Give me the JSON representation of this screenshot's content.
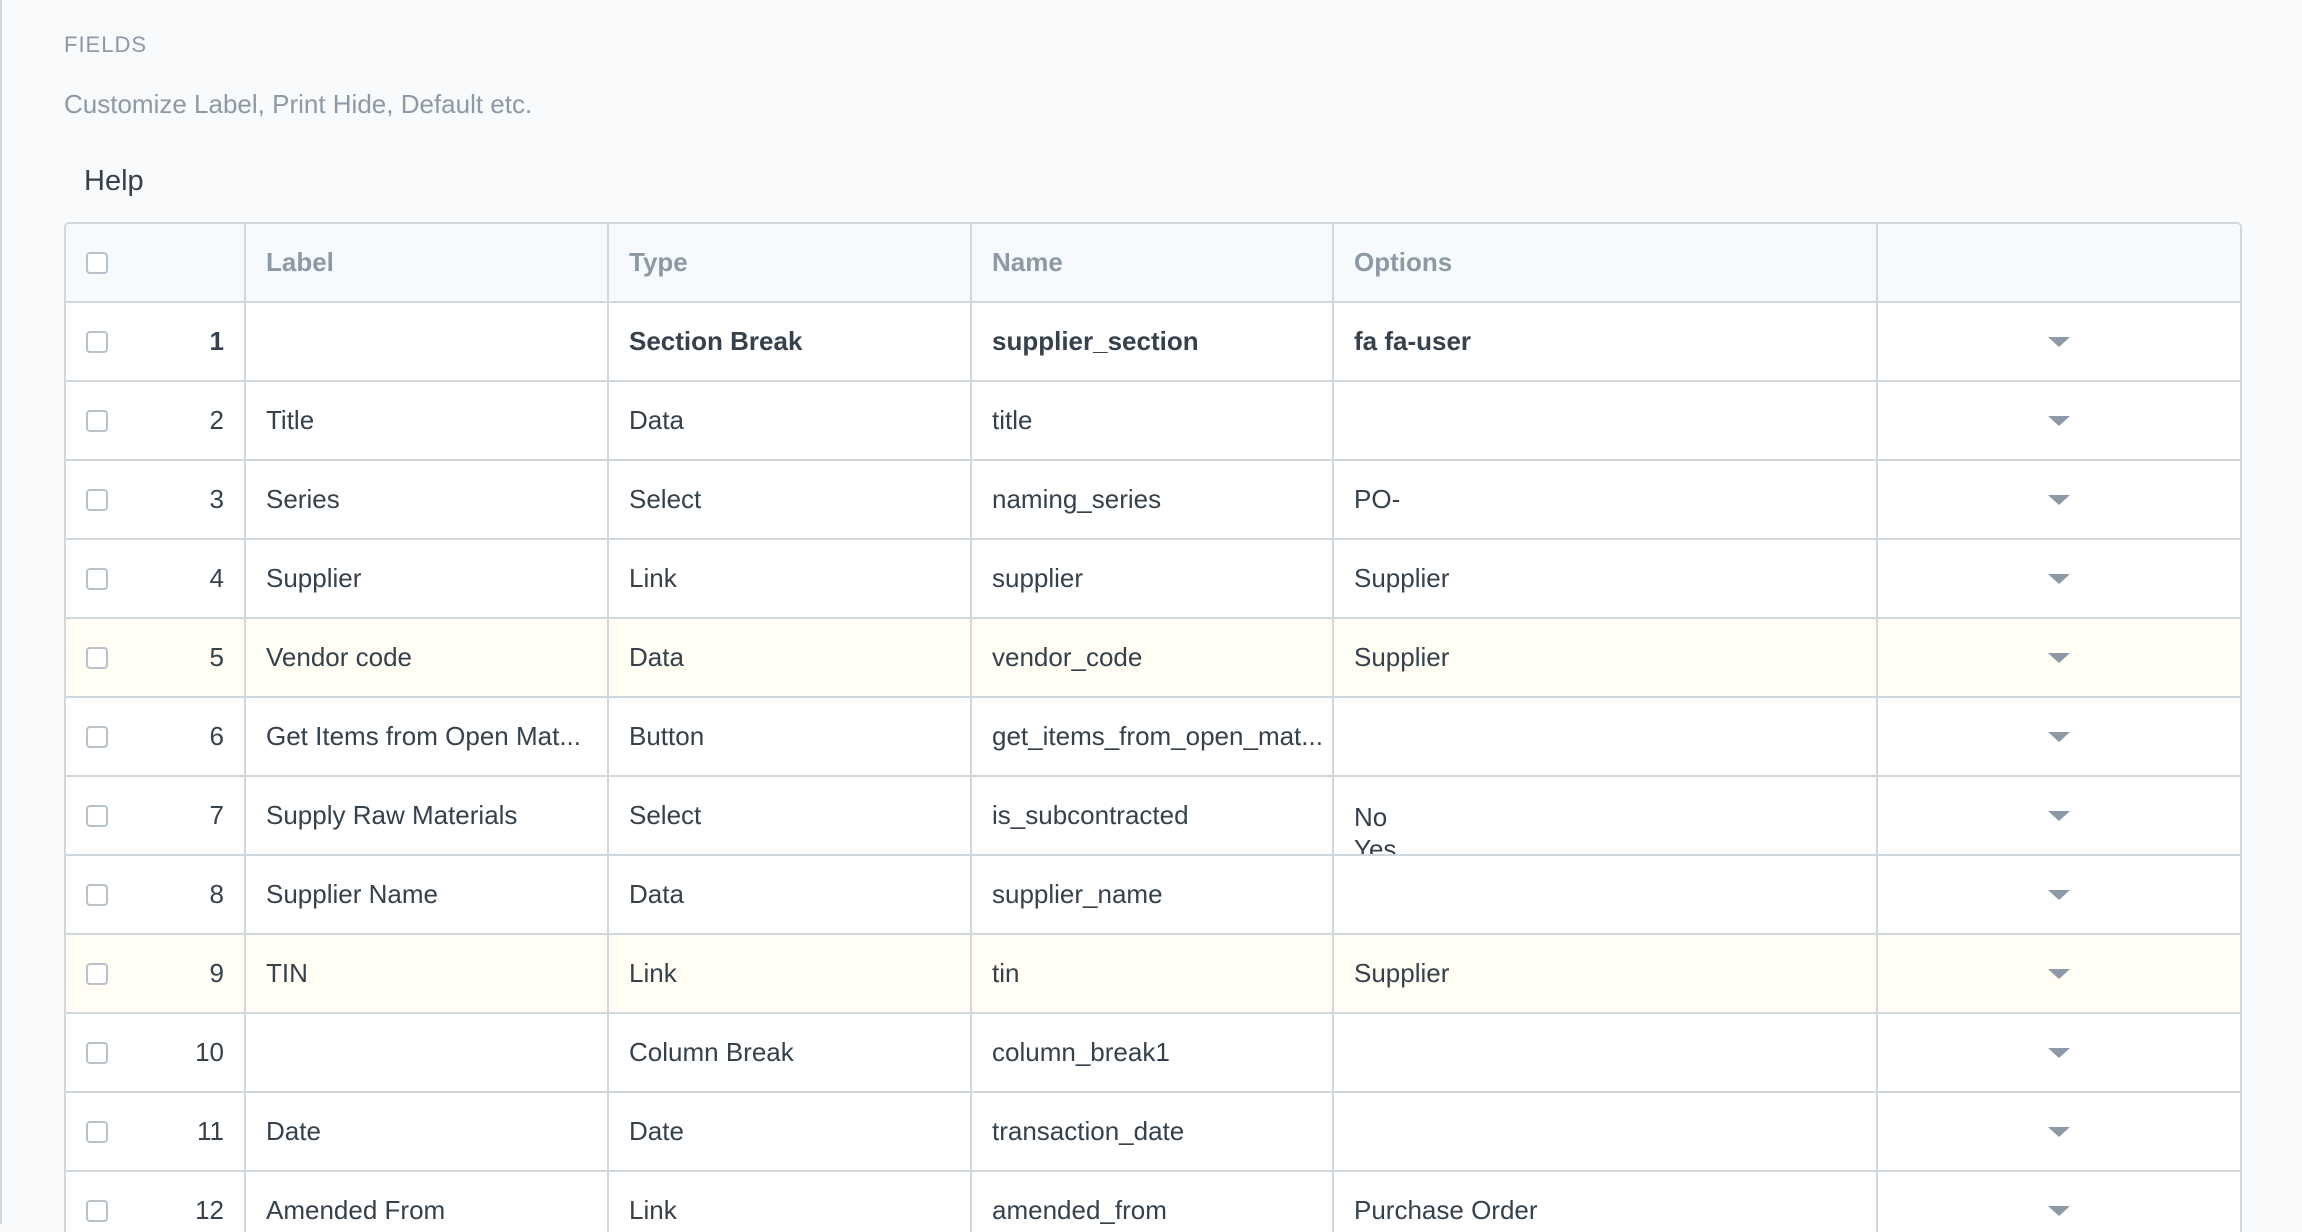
{
  "section": {
    "heading": "FIELDS",
    "description": "Customize Label, Print Hide, Default etc.",
    "help_label": "Help"
  },
  "grid": {
    "columns": {
      "label": "Label",
      "type": "Type",
      "name": "Name",
      "options": "Options"
    },
    "rows": [
      {
        "idx": "1",
        "label": "",
        "type": "Section Break",
        "name": "supplier_section",
        "options": "fa fa-user",
        "options2": ""
      },
      {
        "idx": "2",
        "label": "Title",
        "type": "Data",
        "name": "title",
        "options": "",
        "options2": ""
      },
      {
        "idx": "3",
        "label": "Series",
        "type": "Select",
        "name": "naming_series",
        "options": "PO-",
        "options2": ""
      },
      {
        "idx": "4",
        "label": "Supplier",
        "type": "Link",
        "name": "supplier",
        "options": "Supplier",
        "options2": ""
      },
      {
        "idx": "5",
        "label": "Vendor code",
        "type": "Data",
        "name": "vendor_code",
        "options": "Supplier",
        "options2": ""
      },
      {
        "idx": "6",
        "label": "Get Items from Open Mat...",
        "type": "Button",
        "name": "get_items_from_open_mat...",
        "options": "",
        "options2": ""
      },
      {
        "idx": "7",
        "label": "Supply Raw Materials",
        "type": "Select",
        "name": "is_subcontracted",
        "options": "No",
        "options2": "Yes"
      },
      {
        "idx": "8",
        "label": "Supplier Name",
        "type": "Data",
        "name": "supplier_name",
        "options": "",
        "options2": ""
      },
      {
        "idx": "9",
        "label": "TIN",
        "type": "Link",
        "name": "tin",
        "options": "Supplier",
        "options2": ""
      },
      {
        "idx": "10",
        "label": "",
        "type": "Column Break",
        "name": "column_break1",
        "options": "",
        "options2": ""
      },
      {
        "idx": "11",
        "label": "Date",
        "type": "Date",
        "name": "transaction_date",
        "options": "",
        "options2": ""
      },
      {
        "idx": "12",
        "label": "Amended From",
        "type": "Link",
        "name": "amended_from",
        "options": "Purchase Order",
        "options2": ""
      }
    ]
  },
  "colors": {
    "highlight_row": "#fffdf4",
    "border": "#d1d8dd",
    "muted_text": "#8d99a6"
  }
}
